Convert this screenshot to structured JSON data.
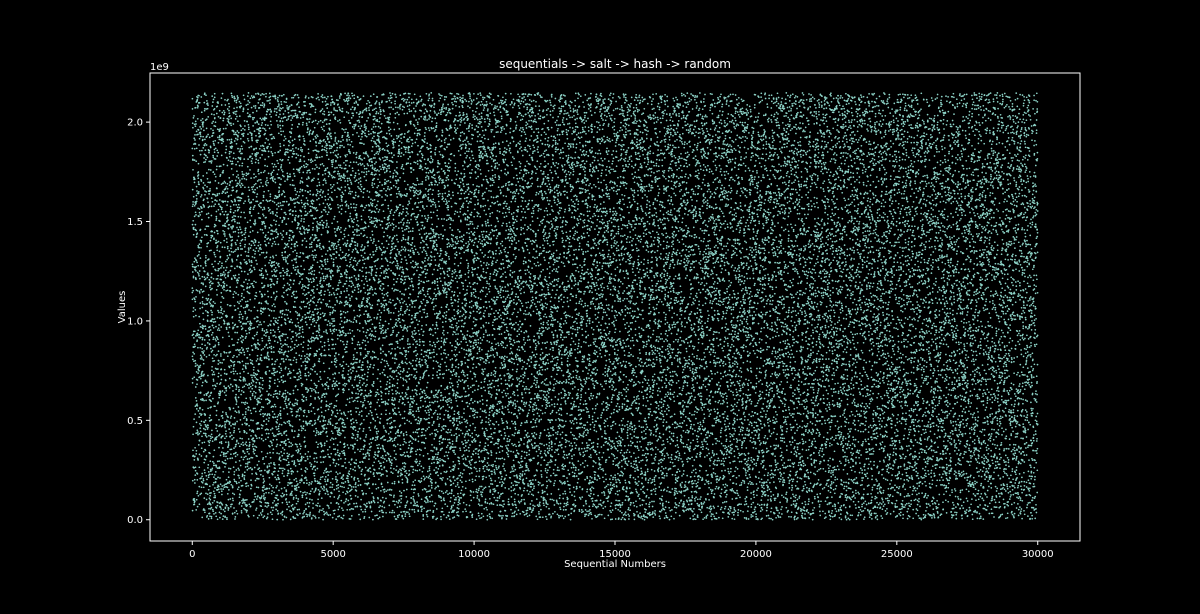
{
  "chart_data": {
    "type": "scatter",
    "title": "sequentials -> salt -> hash -> random",
    "xlabel": "Sequential Numbers",
    "ylabel": "Values",
    "y_offset_label": "1e9",
    "xlim": [
      -1500,
      31500
    ],
    "ylim": [
      -0.107,
      2.247
    ],
    "xticks": [
      0,
      5000,
      10000,
      15000,
      20000,
      25000,
      30000
    ],
    "xtick_labels": [
      "0",
      "5000",
      "10000",
      "15000",
      "20000",
      "25000",
      "30000"
    ],
    "yticks": [
      0.0,
      0.5,
      1.0,
      1.5,
      2.0
    ],
    "ytick_labels": [
      "0.0",
      "0.5",
      "1.0",
      "1.5",
      "2.0"
    ],
    "grid": false,
    "legend": "none",
    "series": [
      {
        "x_range": [
          0,
          30000
        ],
        "y_range": [
          0,
          2.147
        ],
        "point_count": 30000,
        "distribution": "uniform random"
      }
    ],
    "colors": {
      "background": "#000000",
      "axes": "#ffffff",
      "points": "#8dd3c7"
    }
  }
}
